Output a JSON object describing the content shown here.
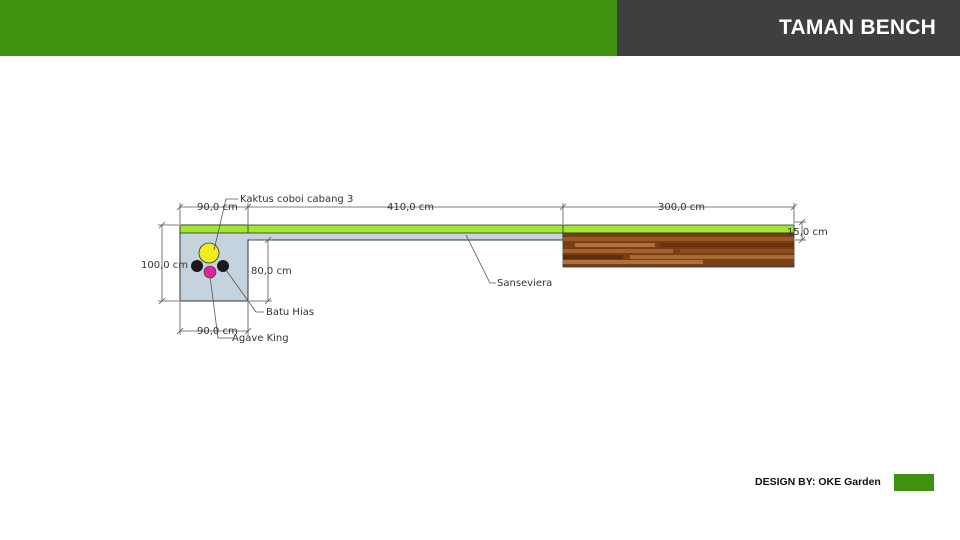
{
  "header": {
    "title": "TAMAN BENCH"
  },
  "plan": {
    "dimensions": {
      "width_left_top": "90,0 cm",
      "length_mid": "410,0 cm",
      "length_right": "300,0 cm",
      "height_left": "100,0 cm",
      "height_inner": "80,0 cm",
      "depth_right": "15,0 cm",
      "width_left_bottom": "90,0 cm"
    },
    "labels": {
      "cactus": "Kaktus coboi cabang 3",
      "sansevieria": "Sanseviera",
      "stones": "Batu Hias",
      "agave": "Agave King"
    }
  },
  "footer": {
    "credit": "DESIGN BY: OKE Garden"
  },
  "colors": {
    "brand_green": "#3f920f",
    "header_dark": "#3f3f3f",
    "grass": "#a3e630",
    "planter": "#c4d3de",
    "wood": "#8a4a1c",
    "cactus": "#f0ec1e",
    "agave": "#e0259a",
    "stone": "#1a1a1a"
  }
}
